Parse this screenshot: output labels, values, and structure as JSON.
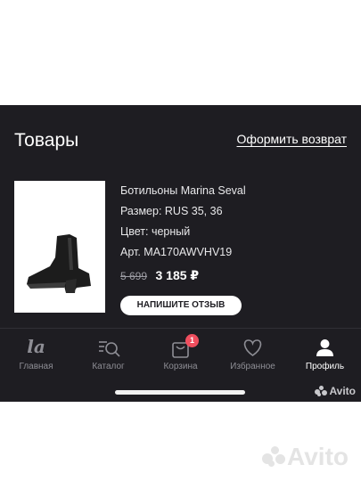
{
  "header": {
    "title": "Товары",
    "return_link": "Оформить возврат"
  },
  "product": {
    "name": "Ботильоны Marina Seval",
    "size": "Размер: RUS 35, 36",
    "color": "Цвет: черный",
    "article": "Арт. MA170AWVHV19",
    "old_price": "5 699",
    "new_price": "3 185 ₽",
    "review_button": "НАПИШИТЕ ОТЗЫВ"
  },
  "tabbar": {
    "items": [
      {
        "label": "Главная",
        "icon": "la-logo-icon"
      },
      {
        "label": "Каталог",
        "icon": "catalog-search-icon"
      },
      {
        "label": "Корзина",
        "icon": "cart-bag-icon",
        "badge": "1"
      },
      {
        "label": "Избранное",
        "icon": "heart-icon"
      },
      {
        "label": "Профиль",
        "icon": "profile-icon",
        "active": true
      }
    ],
    "logo_text": "la"
  },
  "watermark": {
    "small": "Avito",
    "large": "Avito"
  },
  "colors": {
    "background": "#1e1d22",
    "badge": "#ef4e5e",
    "accent_text": "#ffffff"
  }
}
